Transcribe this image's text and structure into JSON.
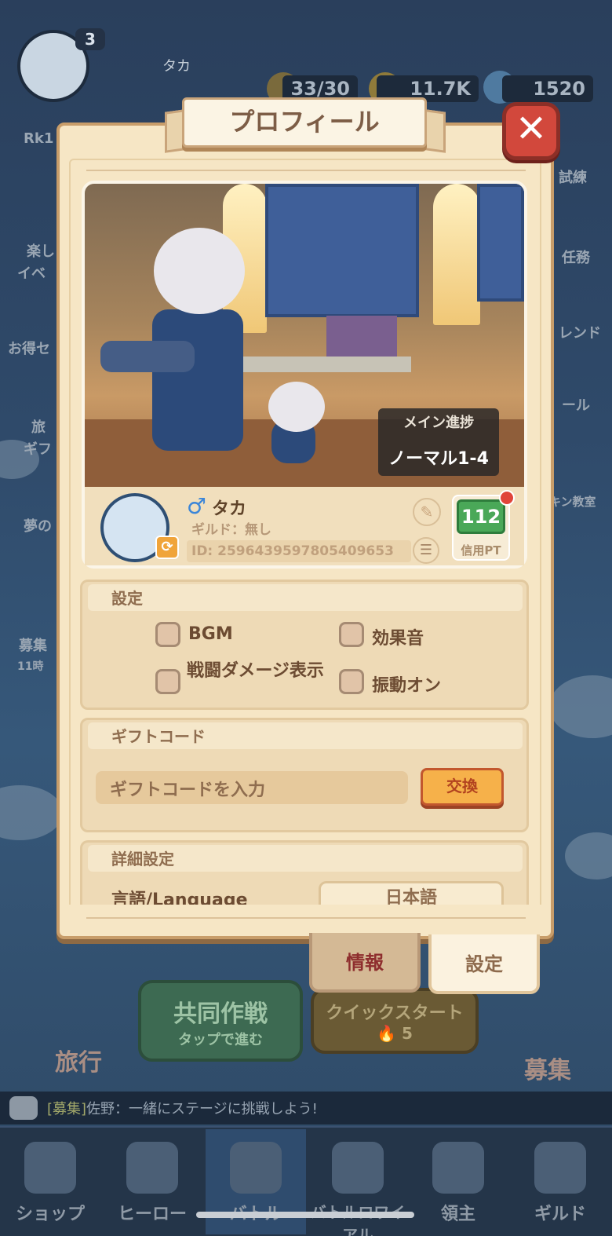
{
  "hud": {
    "player_level": "3",
    "player_name": "タカ",
    "stamina": "33/30",
    "gold": "11.7K",
    "gems": "1520",
    "rank_hint": "Rk1"
  },
  "side_labels": {
    "left": [
      "楽し",
      "イベ",
      "お得セ",
      "旅",
      "ギフ",
      "夢の",
      "募集",
      "11時"
    ],
    "right": [
      "試練",
      "任務",
      "レンド",
      "ール",
      "キン教室"
    ]
  },
  "modal": {
    "title": "プロフィール",
    "close_icon": "close-x",
    "progress": {
      "title": "メイン進捗",
      "value": "ノーマル1-4"
    },
    "profile": {
      "gender_symbol": "♂",
      "name": "タカ",
      "guild": "ギルド：無し",
      "id": "ID: 2596439597805409653",
      "credit_value": "112",
      "credit_label": "信用PT"
    },
    "settings": {
      "title": "設定",
      "options": [
        {
          "label": "BGM",
          "checked": false
        },
        {
          "label": "効果音",
          "checked": false
        },
        {
          "label": "戦闘ダメージ表示",
          "checked": false
        },
        {
          "label": "振動オン",
          "checked": false
        }
      ]
    },
    "gift_code": {
      "title": "ギフトコード",
      "placeholder": "ギフトコードを入力",
      "button": "交換"
    },
    "advanced": {
      "title": "詳細設定",
      "language_label": "言語/Language",
      "language_value": "日本語"
    },
    "tabs": [
      {
        "label": "情報",
        "active": false
      },
      {
        "label": "設定",
        "active": true
      }
    ]
  },
  "battle_area": {
    "coop_title": "共同作戦",
    "coop_sub": "タップで進む",
    "quick_title": "クイックスタート",
    "quick_cost": "5",
    "travel": "旅行",
    "recruit": "募集"
  },
  "chat": {
    "tag": "[募集]",
    "text": "佐野：一緒にステージに挑戦しよう!"
  },
  "nav": [
    {
      "label": "ショップ",
      "icon": "shop-icon"
    },
    {
      "label": "ヒーロー",
      "icon": "hero-icon"
    },
    {
      "label": "バトル",
      "icon": "battle-icon"
    },
    {
      "label": "バトルロワイアル",
      "icon": "royale-icon"
    },
    {
      "label": "領主",
      "icon": "lord-icon"
    },
    {
      "label": "ギルド",
      "icon": "guild-icon"
    }
  ],
  "colors": {
    "modal_bg": "#f6e6c5",
    "close_red": "#d2483c",
    "credit_green": "#4aa858",
    "exchange_orange": "#f6b14a"
  }
}
